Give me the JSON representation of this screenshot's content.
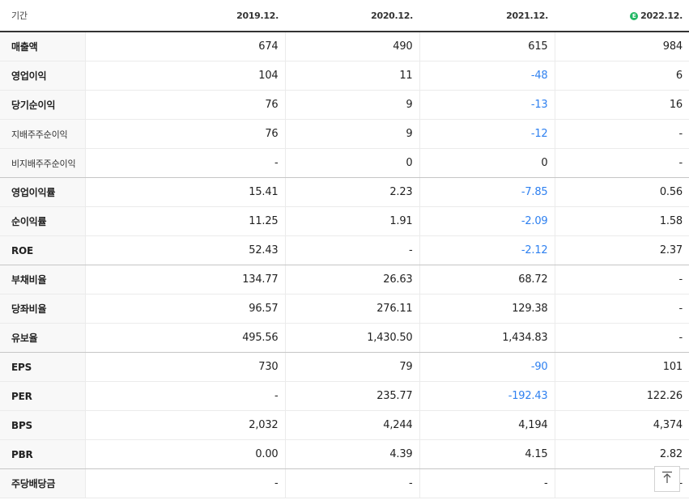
{
  "header": {
    "period_label": "기간",
    "years": [
      {
        "label": "2019.12.",
        "estimate": false
      },
      {
        "label": "2020.12.",
        "estimate": false
      },
      {
        "label": "2021.12.",
        "estimate": false
      },
      {
        "label": "2022.12.",
        "estimate": true
      }
    ],
    "estimate_badge": "E"
  },
  "rows": [
    {
      "label": "매출액",
      "values": [
        "674",
        "490",
        "615",
        "984"
      ]
    },
    {
      "label": "영업이익",
      "values": [
        "104",
        "11",
        "-48",
        "6"
      ]
    },
    {
      "label": "당기순이익",
      "values": [
        "76",
        "9",
        "-13",
        "16"
      ]
    },
    {
      "label": "지배주주순이익",
      "values": [
        "76",
        "9",
        "-12",
        "-"
      ]
    },
    {
      "label": "비지배주주순이익",
      "values": [
        "-",
        "0",
        "0",
        "-"
      ]
    },
    {
      "label": "영업이익률",
      "values": [
        "15.41",
        "2.23",
        "-7.85",
        "0.56"
      ]
    },
    {
      "label": "순이익률",
      "values": [
        "11.25",
        "1.91",
        "-2.09",
        "1.58"
      ]
    },
    {
      "label": "ROE",
      "values": [
        "52.43",
        "-",
        "-2.12",
        "2.37"
      ]
    },
    {
      "label": "부채비율",
      "values": [
        "134.77",
        "26.63",
        "68.72",
        "-"
      ]
    },
    {
      "label": "당좌비율",
      "values": [
        "96.57",
        "276.11",
        "129.38",
        "-"
      ]
    },
    {
      "label": "유보율",
      "values": [
        "495.56",
        "1,430.50",
        "1,434.83",
        "-"
      ]
    },
    {
      "label": "EPS",
      "values": [
        "730",
        "79",
        "-90",
        "101"
      ]
    },
    {
      "label": "PER",
      "values": [
        "-",
        "235.77",
        "-192.43",
        "122.26"
      ]
    },
    {
      "label": "BPS",
      "values": [
        "2,032",
        "4,244",
        "4,194",
        "4,374"
      ]
    },
    {
      "label": "PBR",
      "values": [
        "0.00",
        "4.39",
        "4.15",
        "2.82"
      ]
    },
    {
      "label": "주당배당금",
      "values": [
        "-",
        "-",
        "-",
        "-"
      ]
    }
  ],
  "colors": {
    "negative": "#2e80f0",
    "estimate_badge": "#23b865",
    "label_bg": "#f8f8f8"
  },
  "icons": {
    "estimate": "estimate-badge-icon",
    "scroll_top": "arrow-up-icon"
  }
}
